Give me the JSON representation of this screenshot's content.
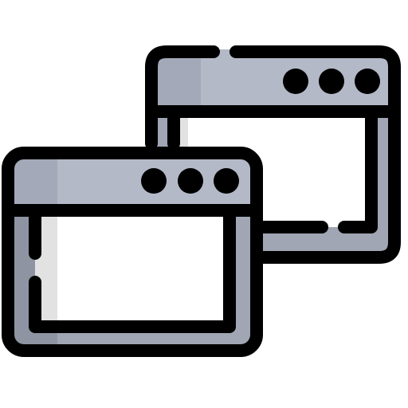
{
  "icon": {
    "name": "multiple-windows-icon",
    "description_elements": [
      "back-window",
      "front-window"
    ],
    "colors": {
      "frame_gray": "#a0a6b4",
      "frame_shadow": "#8e94a2",
      "titlebar_gray": "#b4b9c8",
      "titlebar_shadow": "#a3a9b8",
      "content_white": "#ffffff",
      "content_shadow": "#e2e2e2",
      "outline": "#000000"
    }
  }
}
